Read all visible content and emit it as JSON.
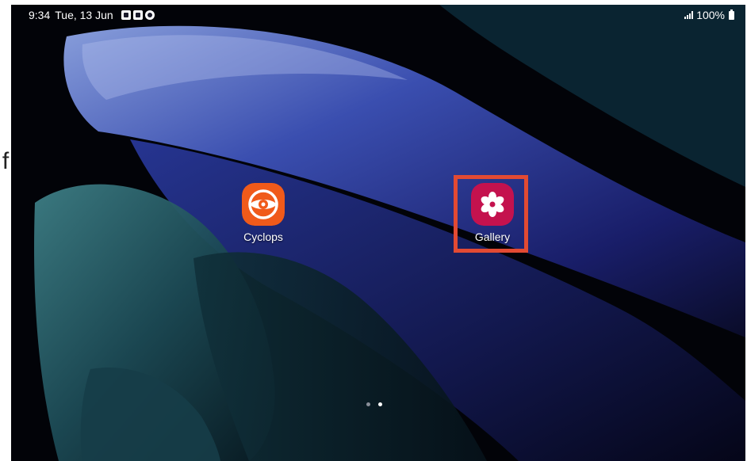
{
  "margin_glyph": "f",
  "status_bar": {
    "time": "9:34",
    "date": "Tue, 13 Jun",
    "notification_icons": [
      "contact-card-icon",
      "image-icon",
      "at-sign-icon"
    ],
    "signal_icon": "signal-bars-icon",
    "battery_percent": "100%",
    "battery_icon": "battery-icon"
  },
  "home_screen": {
    "apps": [
      {
        "label": "Cyclops",
        "icon": "cyclops-eye-icon",
        "color": "#f05a1a"
      },
      {
        "label": "Gallery",
        "icon": "flower-icon",
        "color": "#c4124e"
      }
    ],
    "highlight_color": "#e24a33",
    "page_indicator": {
      "total": 2,
      "active": 2
    }
  }
}
